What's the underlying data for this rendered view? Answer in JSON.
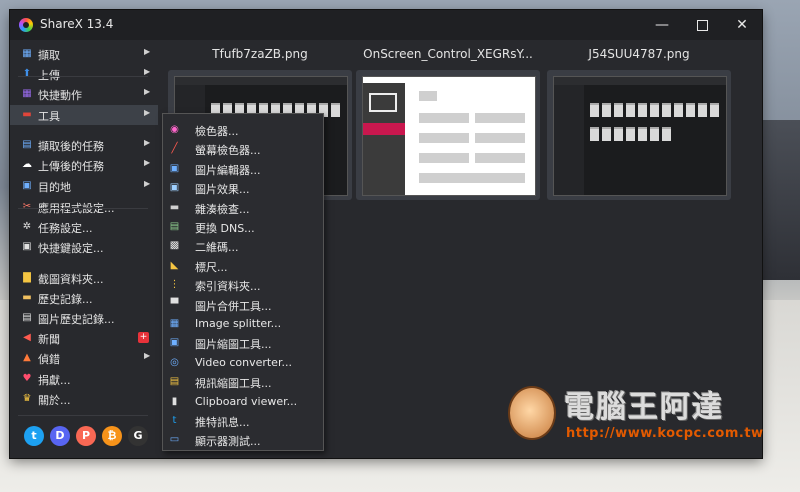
{
  "window": {
    "title": "ShareX 13.4",
    "controls": {
      "minimize": "—",
      "close": "✕"
    }
  },
  "menu": {
    "items": [
      {
        "label": "擷取",
        "icon": "capture-icon",
        "glyph": "▦",
        "color": "#6fb0ff",
        "arrow": "▶"
      },
      {
        "label": "上傳",
        "icon": "upload-icon",
        "glyph": "⬆",
        "color": "#3f8fe8",
        "arrow": "▶"
      },
      {
        "label": "快捷動作",
        "icon": "workflow-icon",
        "glyph": "▦",
        "color": "#9b6cf0",
        "arrow": "▶"
      },
      {
        "label": "工具",
        "icon": "tools-icon",
        "glyph": "▬",
        "color": "#e0453a",
        "arrow": "▶"
      },
      {
        "label": "擷取後的任務",
        "icon": "after-capture-icon",
        "glyph": "▤",
        "color": "#6fb0ff",
        "arrow": "▶"
      },
      {
        "label": "上傳後的任務",
        "icon": "after-upload-icon",
        "glyph": "☁",
        "color": "#ffffff",
        "arrow": "▶"
      },
      {
        "label": "目的地",
        "icon": "destination-icon",
        "glyph": "▣",
        "color": "#6fb0ff",
        "arrow": "▶"
      },
      {
        "label": "應用程式設定...",
        "icon": "app-settings-icon",
        "glyph": "✂",
        "color": "#ff7a6a",
        "arrow": ""
      },
      {
        "label": "任務設定...",
        "icon": "task-settings-icon",
        "glyph": "✲",
        "color": "#e0e0e0",
        "arrow": ""
      },
      {
        "label": "快捷鍵設定...",
        "icon": "hotkey-settings-icon",
        "glyph": "▣",
        "color": "#e0e0e0",
        "arrow": ""
      },
      {
        "label": "截圖資料夾...",
        "icon": "folder-icon",
        "glyph": "▇",
        "color": "#f4c542",
        "arrow": ""
      },
      {
        "label": "歷史記錄...",
        "icon": "history-icon",
        "glyph": "▬",
        "color": "#f0c060",
        "arrow": ""
      },
      {
        "label": "圖片歷史記錄...",
        "icon": "image-history-icon",
        "glyph": "▤",
        "color": "#e0e0e0",
        "arrow": ""
      },
      {
        "label": "新聞",
        "icon": "news-icon",
        "glyph": "◀",
        "color": "#ff5a4f",
        "arrow": ""
      },
      {
        "label": "偵錯",
        "icon": "debug-icon",
        "glyph": "▲",
        "color": "#ff7a3a",
        "arrow": "▶"
      },
      {
        "label": "捐獻...",
        "icon": "heart-icon",
        "glyph": "♥",
        "color": "#ff4d6d",
        "arrow": ""
      },
      {
        "label": "關於...",
        "icon": "crown-icon",
        "glyph": "♛",
        "color": "#f5c542",
        "arrow": ""
      }
    ],
    "news_badge": "+"
  },
  "social": [
    {
      "name": "twitter-icon",
      "glyph": "t",
      "color": "#1da1f2"
    },
    {
      "name": "discord-icon",
      "glyph": "D",
      "color": "#5865f2"
    },
    {
      "name": "patreon-icon",
      "glyph": "P",
      "color": "#f96854"
    },
    {
      "name": "bitcoin-icon",
      "glyph": "₿",
      "color": "#f7931a"
    },
    {
      "name": "github-icon",
      "glyph": "G",
      "color": "#333333"
    }
  ],
  "thumbnails": [
    {
      "filename": "Tfufb7zaZB.png"
    },
    {
      "filename": "OnScreen_Control_XEGRsY..."
    },
    {
      "filename": "J54SUU4787.png"
    }
  ],
  "tools_submenu": {
    "items": [
      {
        "label": "檢色器...",
        "icon": "color-picker-icon",
        "glyph": "◉",
        "color": "#ff66cc"
      },
      {
        "label": "螢幕檢色器...",
        "icon": "screen-color-picker-icon",
        "glyph": "╱",
        "color": "#ff5a4f"
      },
      {
        "label": "圖片編輯器...",
        "icon": "image-editor-icon",
        "glyph": "▣",
        "color": "#6fb0ff"
      },
      {
        "label": "圖片效果...",
        "icon": "image-effects-icon",
        "glyph": "▣",
        "color": "#9fd0ff"
      },
      {
        "label": "雜湊檢查...",
        "icon": "hash-check-icon",
        "glyph": "▬",
        "color": "#d0d0d0"
      },
      {
        "label": "更換 DNS...",
        "icon": "dns-icon",
        "glyph": "▤",
        "color": "#8fd08f"
      },
      {
        "label": "二維碼...",
        "icon": "qr-code-icon",
        "glyph": "▩",
        "color": "#e0e0e0"
      },
      {
        "label": "標尺...",
        "icon": "ruler-icon",
        "glyph": "◣",
        "color": "#f5c542"
      },
      {
        "label": "索引資料夾...",
        "icon": "index-folder-icon",
        "glyph": "⋮",
        "color": "#f4c542"
      },
      {
        "label": "圖片合併工具...",
        "icon": "image-combiner-icon",
        "glyph": "▀",
        "color": "#e0e0e0"
      },
      {
        "label": "Image splitter...",
        "icon": "image-splitter-icon",
        "glyph": "▦",
        "color": "#6fb0ff"
      },
      {
        "label": "圖片縮圖工具...",
        "icon": "image-thumbnailer-icon",
        "glyph": "▣",
        "color": "#6fb0ff"
      },
      {
        "label": "Video converter...",
        "icon": "video-converter-icon",
        "glyph": "◎",
        "color": "#6fb0ff"
      },
      {
        "label": "視訊縮圖工具...",
        "icon": "video-thumbnailer-icon",
        "glyph": "▤",
        "color": "#f4c542"
      },
      {
        "label": "Clipboard viewer...",
        "icon": "clipboard-icon",
        "glyph": "▮",
        "color": "#e0e0e0"
      },
      {
        "label": "推特訊息...",
        "icon": "tweet-icon",
        "glyph": "t",
        "color": "#1da1f2"
      },
      {
        "label": "顯示器測試...",
        "icon": "monitor-test-icon",
        "glyph": "▭",
        "color": "#6fb0ff"
      }
    ]
  },
  "watermark": {
    "title": "電腦王阿達",
    "url": "http://www.kocpc.com.tw"
  }
}
